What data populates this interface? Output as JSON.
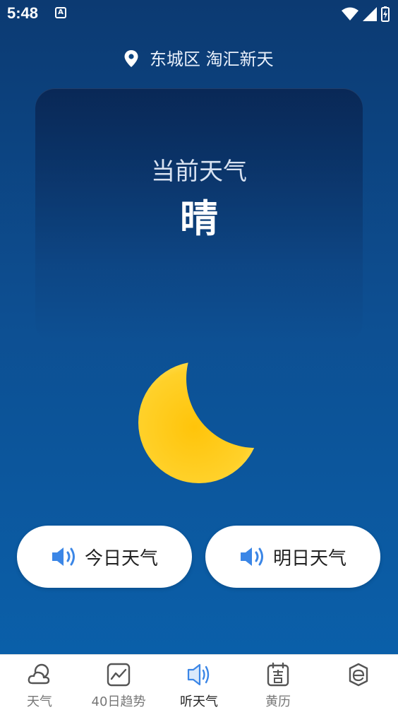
{
  "status": {
    "time": "5:48",
    "notification_badge": "A"
  },
  "location": {
    "text": "东城区 淘汇新天",
    "icon": "location-pin-icon"
  },
  "current": {
    "title": "当前天气",
    "weather": "晴",
    "illustration": "moon-icon"
  },
  "actions": {
    "today": "今日天气",
    "tomorrow": "明日天气",
    "icon": "speaker-icon"
  },
  "tabs": [
    {
      "label": "天气",
      "icon": "cloud-icon",
      "active": false
    },
    {
      "label": "40日趋势",
      "icon": "trend-chart-icon",
      "active": false
    },
    {
      "label": "听天气",
      "icon": "speaker-icon",
      "active": true
    },
    {
      "label": "黄历",
      "icon": "calendar-icon",
      "active": false
    },
    {
      "label": "",
      "icon": "profile-icon",
      "active": false
    }
  ],
  "colors": {
    "background_top": "#0c3a72",
    "background_bottom": "#0a62ad",
    "accent": "#3b86e6",
    "moon": "#ffcc19"
  }
}
